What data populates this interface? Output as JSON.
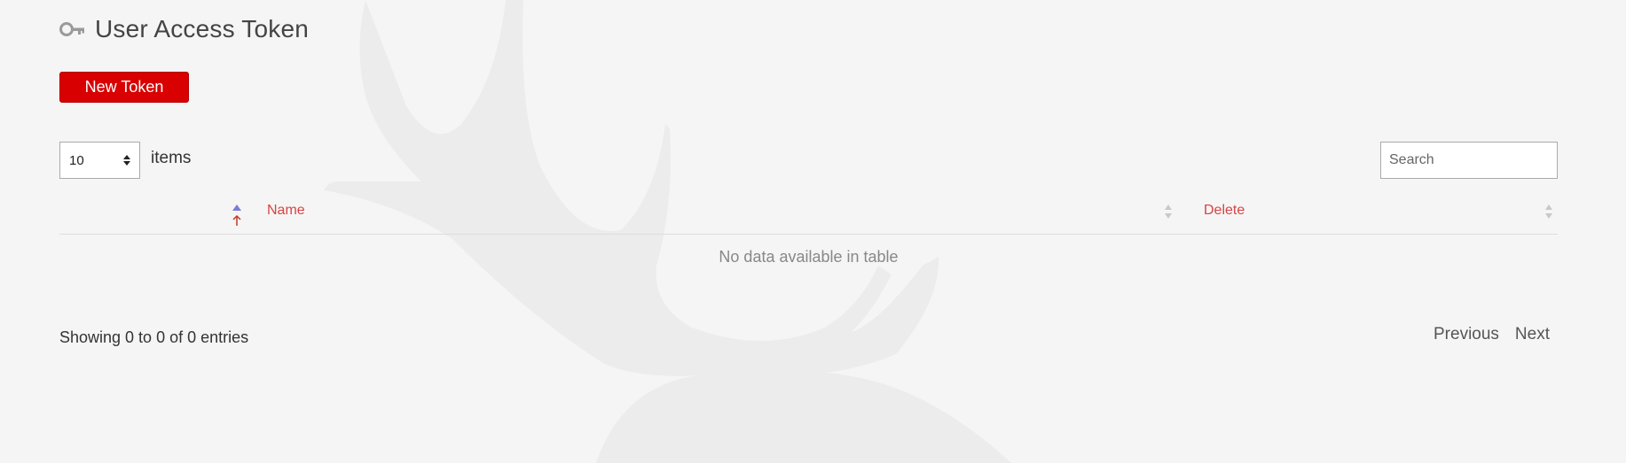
{
  "page": {
    "title": "User Access Token",
    "icon": "key-icon"
  },
  "toolbar": {
    "new_token_label": "New Token"
  },
  "table_controls": {
    "length_value": "10",
    "length_label": "items",
    "search_placeholder": "Search"
  },
  "table": {
    "columns": [
      "",
      "Name",
      "Delete"
    ],
    "empty_message": "No data available in table"
  },
  "footer": {
    "info": "Showing 0 to 0 of 0 entries",
    "previous_label": "Previous",
    "next_label": "Next"
  },
  "colors": {
    "accent": "#d80000",
    "header_link": "#d84343",
    "background": "#f5f5f5",
    "watermark": "#ebebeb"
  }
}
